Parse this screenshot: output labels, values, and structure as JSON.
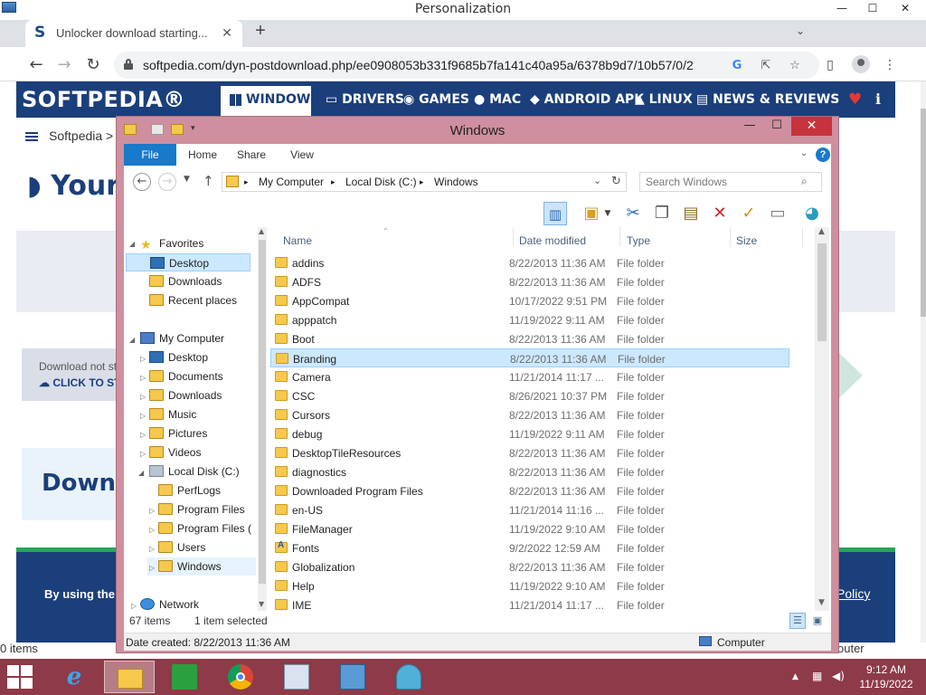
{
  "os_window": {
    "title": "Personalization",
    "min": "—",
    "max": "☐",
    "close": "✕"
  },
  "chrome": {
    "tab_title": "Unlocker download starting...",
    "tab_close": "✕",
    "new_tab": "+",
    "tab_search": "⌄",
    "url": "softpedia.com/dyn-postdownload.php/ee0908053b331f9685b7fa141c40a95a/6378b9d7/10b57/0/2",
    "back": "←",
    "forward": "→",
    "reload": "↻",
    "status_text": "0 items"
  },
  "softpedia": {
    "logo": "SOFTPEDIA®",
    "nav": [
      "WINDOWS",
      "DRIVERS",
      "GAMES",
      "MAC",
      "ANDROID APK",
      "LINUX",
      "NEWS & REVIEWS"
    ],
    "nav_icons": [
      "windows-icon",
      "drivers-icon",
      "games-icon",
      "apple-icon",
      "android-icon",
      "linux-icon",
      "news-icon"
    ],
    "breadcrumb": "Softpedia  >  W",
    "heading_partial": "Your",
    "notice_line1": "Download not st",
    "notice_line2": "CLICK TO ST",
    "download_heading_partial": "Downl",
    "footer_left": "By using the si",
    "footer_right": "Policy",
    "corner_text": "outer"
  },
  "explorer": {
    "title": "Windows",
    "close": "✕",
    "ribbon_tabs": [
      "File",
      "Home",
      "Share",
      "View"
    ],
    "address_parts": [
      "My Computer",
      "Local Disk (C:)",
      "Windows"
    ],
    "search_placeholder": "Search Windows",
    "columns": [
      "Name",
      "Date modified",
      "Type",
      "Size"
    ],
    "nav_items": [
      {
        "label": "Favorites",
        "icon": "star-icon"
      },
      {
        "label": "Desktop",
        "icon": "desktop-icon"
      },
      {
        "label": "Downloads",
        "icon": "folder-icon"
      },
      {
        "label": "Recent places",
        "icon": "folder-icon"
      },
      {
        "label": "My Computer",
        "icon": "computer-icon"
      },
      {
        "label": "Desktop",
        "icon": "desktop-icon"
      },
      {
        "label": "Documents",
        "icon": "folder-icon"
      },
      {
        "label": "Downloads",
        "icon": "folder-icon"
      },
      {
        "label": "Music",
        "icon": "folder-icon"
      },
      {
        "label": "Pictures",
        "icon": "folder-icon"
      },
      {
        "label": "Videos",
        "icon": "folder-icon"
      },
      {
        "label": "Local Disk (C:)",
        "icon": "drive-icon"
      },
      {
        "label": "PerfLogs",
        "icon": "folder-icon"
      },
      {
        "label": "Program Files",
        "icon": "folder-icon"
      },
      {
        "label": "Program Files (",
        "icon": "folder-icon"
      },
      {
        "label": "Users",
        "icon": "folder-icon"
      },
      {
        "label": "Windows",
        "icon": "folder-icon"
      },
      {
        "label": "Network",
        "icon": "network-icon"
      }
    ],
    "files": [
      {
        "name": "addins",
        "date": "8/22/2013 11:36 AM",
        "type": "File folder"
      },
      {
        "name": "ADFS",
        "date": "8/22/2013 11:36 AM",
        "type": "File folder"
      },
      {
        "name": "AppCompat",
        "date": "10/17/2022 9:51 PM",
        "type": "File folder"
      },
      {
        "name": "apppatch",
        "date": "11/19/2022 9:11 AM",
        "type": "File folder"
      },
      {
        "name": "Boot",
        "date": "8/22/2013 11:36 AM",
        "type": "File folder"
      },
      {
        "name": "Branding",
        "date": "8/22/2013 11:36 AM",
        "type": "File folder"
      },
      {
        "name": "Camera",
        "date": "11/21/2014 11:17 ...",
        "type": "File folder"
      },
      {
        "name": "CSC",
        "date": "8/26/2021 10:37 PM",
        "type": "File folder"
      },
      {
        "name": "Cursors",
        "date": "8/22/2013 11:36 AM",
        "type": "File folder"
      },
      {
        "name": "debug",
        "date": "11/19/2022 9:11 AM",
        "type": "File folder"
      },
      {
        "name": "DesktopTileResources",
        "date": "8/22/2013 11:36 AM",
        "type": "File folder"
      },
      {
        "name": "diagnostics",
        "date": "8/22/2013 11:36 AM",
        "type": "File folder"
      },
      {
        "name": "Downloaded Program Files",
        "date": "8/22/2013 11:36 AM",
        "type": "File folder"
      },
      {
        "name": "en-US",
        "date": "11/21/2014 11:16 ...",
        "type": "File folder"
      },
      {
        "name": "FileManager",
        "date": "11/19/2022 9:10 AM",
        "type": "File folder"
      },
      {
        "name": "Fonts",
        "date": "9/2/2022 12:59 AM",
        "type": "File folder"
      },
      {
        "name": "Globalization",
        "date": "8/22/2013 11:36 AM",
        "type": "File folder"
      },
      {
        "name": "Help",
        "date": "11/19/2022 9:10 AM",
        "type": "File folder"
      },
      {
        "name": "IME",
        "date": "11/21/2014 11:17 ...",
        "type": "File folder"
      }
    ],
    "item_count": "67 items",
    "selected_count": "1 item selected",
    "details_left": "Date created: 8/22/2013 11:36 AM",
    "details_right": "Computer"
  },
  "taskbar": {
    "time": "9:12 AM",
    "date": "11/19/2022",
    "apps": [
      "internet-explorer-icon",
      "file-explorer-icon",
      "store-icon",
      "chrome-icon",
      "performance-monitor-icon",
      "control-panel-icon",
      "seashell-icon"
    ],
    "tray_arrow": "▲"
  },
  "colors": {
    "softpedia_blue": "#1b3f7b",
    "explorer_frame": "#cf8f9e",
    "taskbar": "#8e3a48",
    "selection": "#cce8ff",
    "ribbon_file": "#1979ca"
  }
}
